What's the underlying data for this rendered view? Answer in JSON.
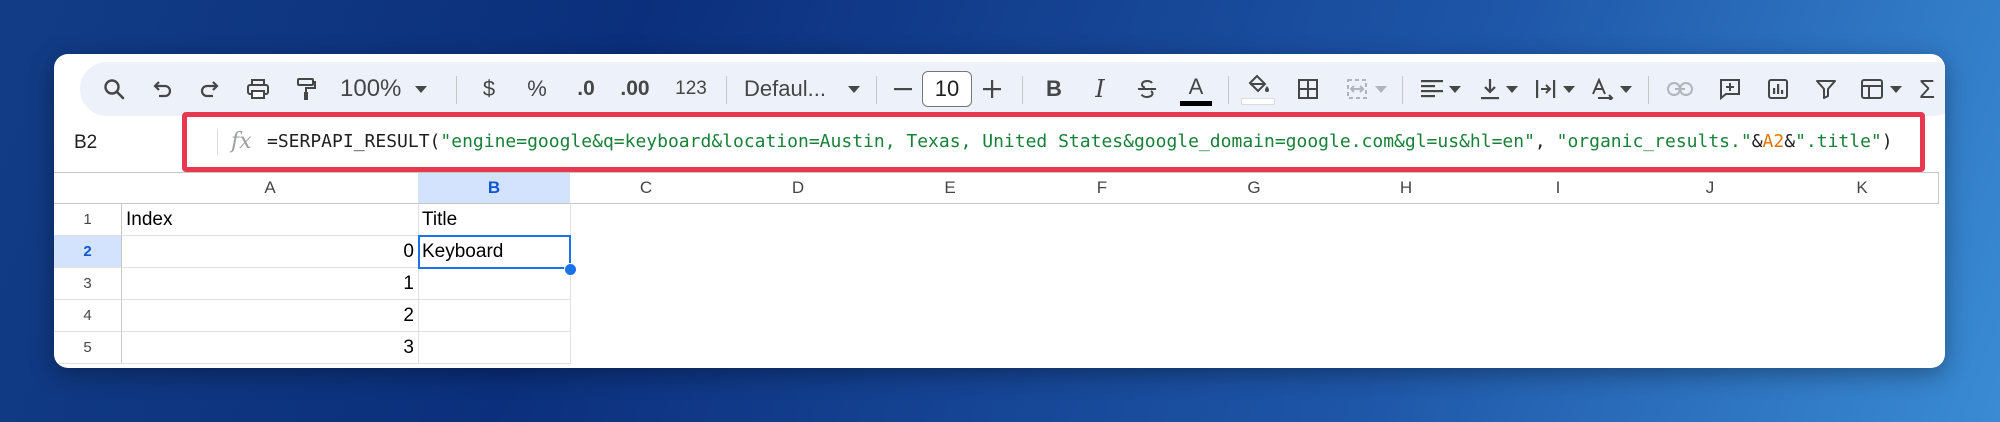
{
  "toolbar": {
    "zoom": "100%",
    "currency": "$",
    "percent": "%",
    "decrease_decimals": ".0",
    "increase_decimals": ".00",
    "number_format": "123",
    "font_name": "Defaul...",
    "font_size": "10",
    "bold": "B",
    "italic": "I",
    "text_color_glyph": "A"
  },
  "formula_bar": {
    "name_box": "B2",
    "fx": "fx",
    "prefix": "=SERPAPI_RESULT(",
    "query_string": "\"engine=google&q=keyboard&location=Austin, Texas, United States&google_domain=google.com&gl=us&hl=en\"",
    "comma": ", ",
    "path_string": "\"organic_results.\"",
    "amp1": "&",
    "ref": "A2",
    "amp2": "&",
    "suffix_string": "\".title\"",
    "close": ")"
  },
  "grid": {
    "columns": [
      "A",
      "B",
      "C",
      "D",
      "E",
      "F",
      "G",
      "H",
      "I",
      "J",
      "K"
    ],
    "rows": [
      "1",
      "2",
      "3",
      "4",
      "5"
    ],
    "cells": {
      "A1": "Index",
      "B1": "Title",
      "A2": "0",
      "B2": "Keyboard",
      "A3": "1",
      "A4": "2",
      "A5": "3"
    }
  }
}
